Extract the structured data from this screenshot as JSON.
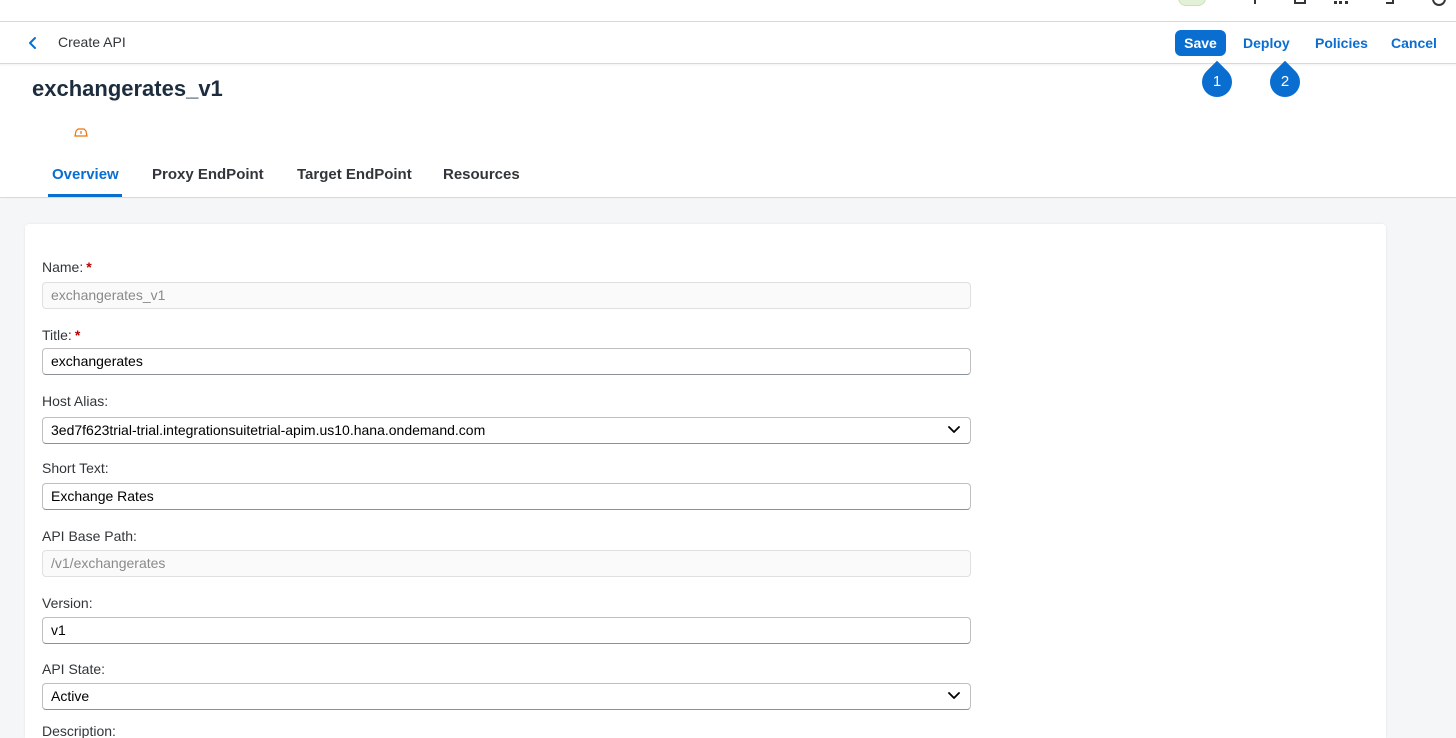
{
  "toolbar": {
    "title": "Create API",
    "actions": {
      "save": "Save",
      "deploy": "Deploy",
      "policies": "Policies",
      "cancel": "Cancel"
    }
  },
  "markers": [
    "1",
    "2"
  ],
  "object": {
    "title": "exchangerates_v1"
  },
  "tabs": [
    {
      "label": "Overview",
      "active": true
    },
    {
      "label": "Proxy EndPoint",
      "active": false
    },
    {
      "label": "Target EndPoint",
      "active": false
    },
    {
      "label": "Resources",
      "active": false
    }
  ],
  "form": {
    "name": {
      "label": "Name:",
      "required_mark": "*",
      "value": "exchangerates_v1"
    },
    "title": {
      "label": "Title:",
      "required_mark": "*",
      "value": "exchangerates"
    },
    "host_alias": {
      "label": "Host Alias:",
      "value": "3ed7f623trial-trial.integrationsuitetrial-apim.us10.hana.ondemand.com"
    },
    "short_text": {
      "label": "Short Text:",
      "value": "Exchange Rates"
    },
    "base_path": {
      "label": "API Base Path:",
      "value": "/v1/exchangerates"
    },
    "version": {
      "label": "Version:",
      "value": "v1"
    },
    "api_state": {
      "label": "API State:",
      "value": "Active"
    },
    "description": {
      "label": "Description:"
    }
  },
  "colors": {
    "accent": "#0a6ed1",
    "required": "#bb0000",
    "warning_icon": "#e9730c",
    "page_bg": "#f5f6f7"
  }
}
